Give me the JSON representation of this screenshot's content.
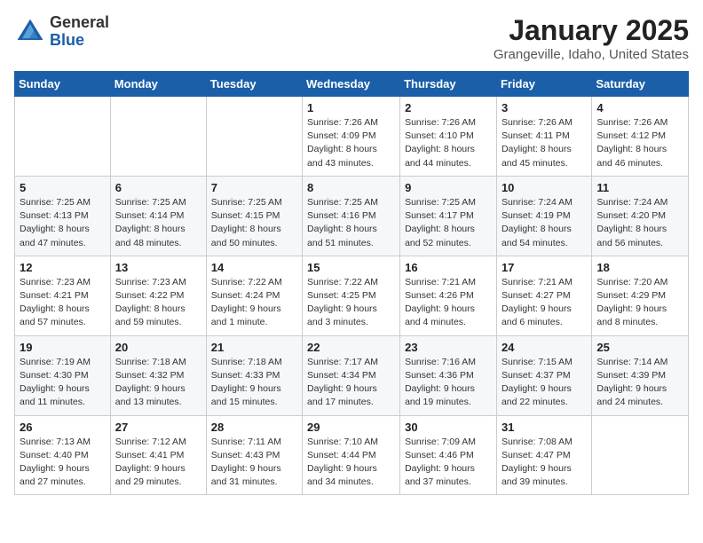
{
  "header": {
    "logo_general": "General",
    "logo_blue": "Blue",
    "month_year": "January 2025",
    "location": "Grangeville, Idaho, United States"
  },
  "weekdays": [
    "Sunday",
    "Monday",
    "Tuesday",
    "Wednesday",
    "Thursday",
    "Friday",
    "Saturday"
  ],
  "weeks": [
    [
      {
        "day": "",
        "detail": ""
      },
      {
        "day": "",
        "detail": ""
      },
      {
        "day": "",
        "detail": ""
      },
      {
        "day": "1",
        "detail": "Sunrise: 7:26 AM\nSunset: 4:09 PM\nDaylight: 8 hours and 43 minutes."
      },
      {
        "day": "2",
        "detail": "Sunrise: 7:26 AM\nSunset: 4:10 PM\nDaylight: 8 hours and 44 minutes."
      },
      {
        "day": "3",
        "detail": "Sunrise: 7:26 AM\nSunset: 4:11 PM\nDaylight: 8 hours and 45 minutes."
      },
      {
        "day": "4",
        "detail": "Sunrise: 7:26 AM\nSunset: 4:12 PM\nDaylight: 8 hours and 46 minutes."
      }
    ],
    [
      {
        "day": "5",
        "detail": "Sunrise: 7:25 AM\nSunset: 4:13 PM\nDaylight: 8 hours and 47 minutes."
      },
      {
        "day": "6",
        "detail": "Sunrise: 7:25 AM\nSunset: 4:14 PM\nDaylight: 8 hours and 48 minutes."
      },
      {
        "day": "7",
        "detail": "Sunrise: 7:25 AM\nSunset: 4:15 PM\nDaylight: 8 hours and 50 minutes."
      },
      {
        "day": "8",
        "detail": "Sunrise: 7:25 AM\nSunset: 4:16 PM\nDaylight: 8 hours and 51 minutes."
      },
      {
        "day": "9",
        "detail": "Sunrise: 7:25 AM\nSunset: 4:17 PM\nDaylight: 8 hours and 52 minutes."
      },
      {
        "day": "10",
        "detail": "Sunrise: 7:24 AM\nSunset: 4:19 PM\nDaylight: 8 hours and 54 minutes."
      },
      {
        "day": "11",
        "detail": "Sunrise: 7:24 AM\nSunset: 4:20 PM\nDaylight: 8 hours and 56 minutes."
      }
    ],
    [
      {
        "day": "12",
        "detail": "Sunrise: 7:23 AM\nSunset: 4:21 PM\nDaylight: 8 hours and 57 minutes."
      },
      {
        "day": "13",
        "detail": "Sunrise: 7:23 AM\nSunset: 4:22 PM\nDaylight: 8 hours and 59 minutes."
      },
      {
        "day": "14",
        "detail": "Sunrise: 7:22 AM\nSunset: 4:24 PM\nDaylight: 9 hours and 1 minute."
      },
      {
        "day": "15",
        "detail": "Sunrise: 7:22 AM\nSunset: 4:25 PM\nDaylight: 9 hours and 3 minutes."
      },
      {
        "day": "16",
        "detail": "Sunrise: 7:21 AM\nSunset: 4:26 PM\nDaylight: 9 hours and 4 minutes."
      },
      {
        "day": "17",
        "detail": "Sunrise: 7:21 AM\nSunset: 4:27 PM\nDaylight: 9 hours and 6 minutes."
      },
      {
        "day": "18",
        "detail": "Sunrise: 7:20 AM\nSunset: 4:29 PM\nDaylight: 9 hours and 8 minutes."
      }
    ],
    [
      {
        "day": "19",
        "detail": "Sunrise: 7:19 AM\nSunset: 4:30 PM\nDaylight: 9 hours and 11 minutes."
      },
      {
        "day": "20",
        "detail": "Sunrise: 7:18 AM\nSunset: 4:32 PM\nDaylight: 9 hours and 13 minutes."
      },
      {
        "day": "21",
        "detail": "Sunrise: 7:18 AM\nSunset: 4:33 PM\nDaylight: 9 hours and 15 minutes."
      },
      {
        "day": "22",
        "detail": "Sunrise: 7:17 AM\nSunset: 4:34 PM\nDaylight: 9 hours and 17 minutes."
      },
      {
        "day": "23",
        "detail": "Sunrise: 7:16 AM\nSunset: 4:36 PM\nDaylight: 9 hours and 19 minutes."
      },
      {
        "day": "24",
        "detail": "Sunrise: 7:15 AM\nSunset: 4:37 PM\nDaylight: 9 hours and 22 minutes."
      },
      {
        "day": "25",
        "detail": "Sunrise: 7:14 AM\nSunset: 4:39 PM\nDaylight: 9 hours and 24 minutes."
      }
    ],
    [
      {
        "day": "26",
        "detail": "Sunrise: 7:13 AM\nSunset: 4:40 PM\nDaylight: 9 hours and 27 minutes."
      },
      {
        "day": "27",
        "detail": "Sunrise: 7:12 AM\nSunset: 4:41 PM\nDaylight: 9 hours and 29 minutes."
      },
      {
        "day": "28",
        "detail": "Sunrise: 7:11 AM\nSunset: 4:43 PM\nDaylight: 9 hours and 31 minutes."
      },
      {
        "day": "29",
        "detail": "Sunrise: 7:10 AM\nSunset: 4:44 PM\nDaylight: 9 hours and 34 minutes."
      },
      {
        "day": "30",
        "detail": "Sunrise: 7:09 AM\nSunset: 4:46 PM\nDaylight: 9 hours and 37 minutes."
      },
      {
        "day": "31",
        "detail": "Sunrise: 7:08 AM\nSunset: 4:47 PM\nDaylight: 9 hours and 39 minutes."
      },
      {
        "day": "",
        "detail": ""
      }
    ]
  ]
}
